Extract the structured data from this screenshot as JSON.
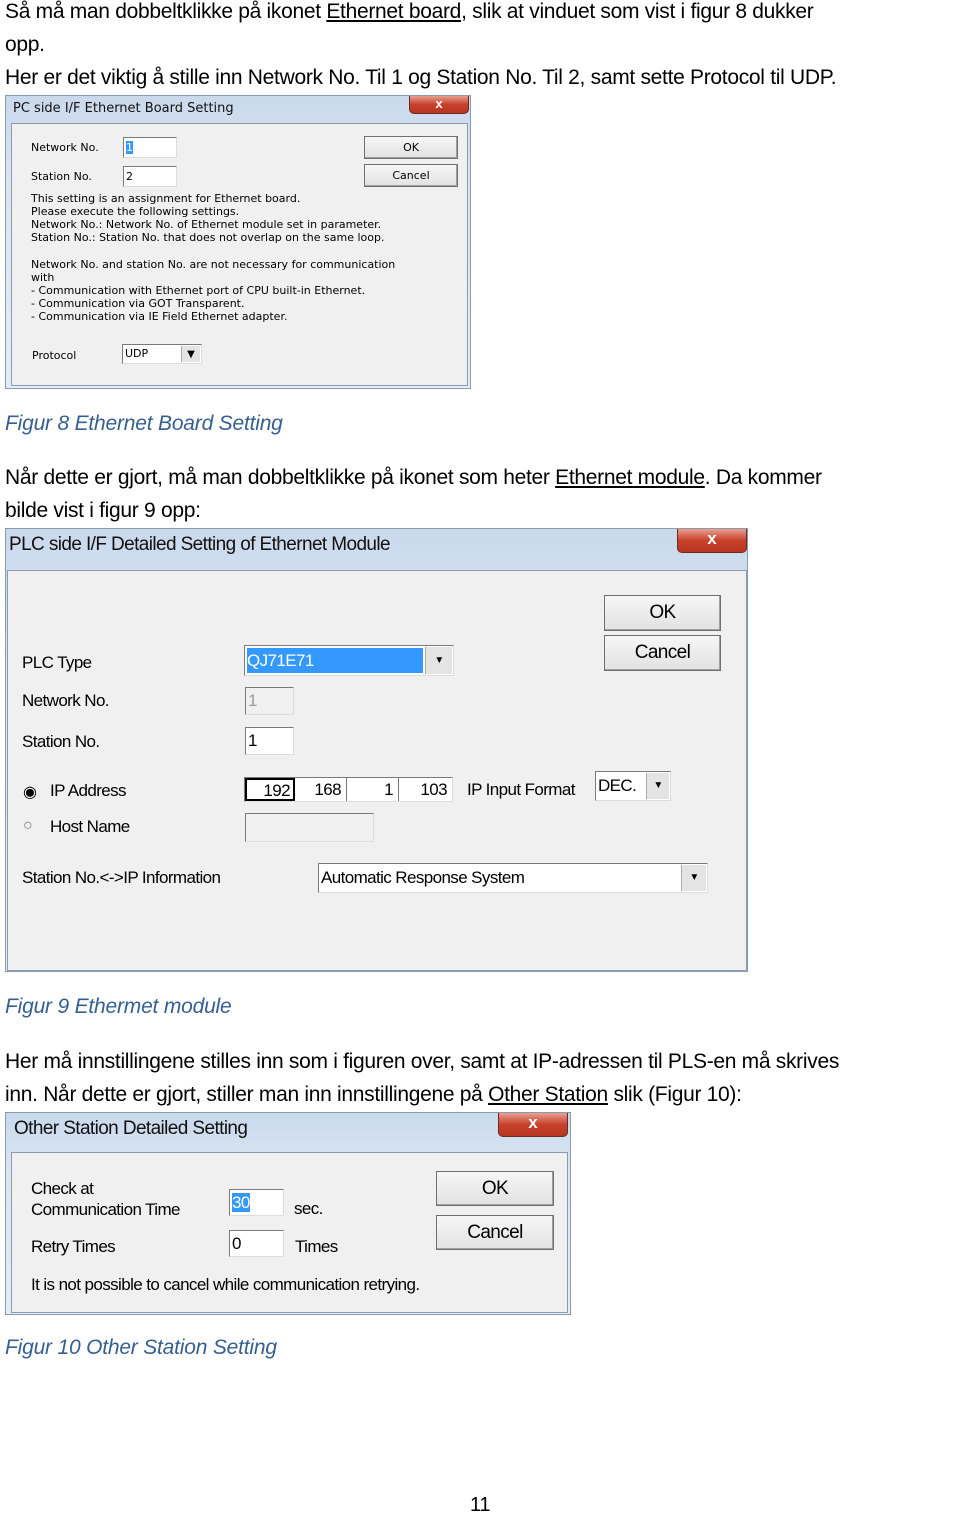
{
  "doc": {
    "p1_a": "Så må man dobbeltklikke på ikonet ",
    "p1_link": "Ethernet board",
    "p1_b": ", slik at vinduet som vist i figur 8 dukker",
    "p1_c": "opp.",
    "p2": "Her er det viktig å stille inn Network No. Til 1 og Station No. Til 2, samt sette Protocol til UDP.",
    "cap8": "Figur 8 Ethernet Board Setting",
    "p3_a": "Når dette er gjort, må man dobbeltklikke på ikonet som heter ",
    "p3_link": "Ethernet module",
    "p3_b": ". Da kommer",
    "p3_c": "bilde vist i figur 9 opp:",
    "cap9": "Figur 9 Ethermet module",
    "p4_a": "Her må innstillingene stilles inn som i figuren over, samt at IP-adressen til PLS-en må skrives",
    "p4_b": "inn. Når dette er gjort, stiller man inn innstillingene på ",
    "p4_link": "Other Station",
    "p4_c": " slik (Figur 10):",
    "cap10": "Figur 10 Other Station Setting",
    "page_number": "11"
  },
  "fig8": {
    "title": "PC side I/F Ethernet Board Setting",
    "close": "x",
    "network_label": "Network No.",
    "network_value": "1",
    "station_label": "Station No.",
    "station_value": "2",
    "ok": "OK",
    "cancel": "Cancel",
    "info": [
      "This setting is an assignment for Ethernet board.",
      "Please execute the following settings.",
      "Network No.: Network No. of Ethernet module set in parameter.",
      "Station No.: Station No. that does not overlap on the same loop."
    ],
    "info2": [
      "Network No. and station No. are not necessary for communication",
      "with",
      "- Communication with Ethernet port of CPU built-in Ethernet.",
      "- Communication via GOT Transparent.",
      "- Communication via IE Field Ethernet adapter."
    ],
    "protocol_label": "Protocol",
    "protocol_value": "UDP"
  },
  "fig9": {
    "title": "PLC side I/F Detailed Setting of Ethernet Module",
    "close": "x",
    "ok": "OK",
    "cancel": "Cancel",
    "plc_type_label": "PLC Type",
    "plc_type_value": "QJ71E71",
    "network_label": "Network No.",
    "network_value": "1",
    "station_label": "Station No.",
    "station_value": "1",
    "ip_label": "IP Address",
    "ip": [
      "192",
      "168",
      "1",
      "103"
    ],
    "ip_format_label": "IP Input Format",
    "ip_format_value": "DEC.",
    "host_label": "Host Name",
    "host_value": "",
    "info_label": "Station No.<->IP Information",
    "info_value": "Automatic Response System",
    "selected_radio": "IP Address"
  },
  "fig10": {
    "title": "Other Station Detailed Setting",
    "close": "x",
    "check_label_1": "Check at",
    "check_label_2": "Communication Time",
    "check_value": "30",
    "check_unit": "sec.",
    "retry_label": "Retry Times",
    "retry_value": "0",
    "retry_unit": "Times",
    "ok": "OK",
    "cancel": "Cancel",
    "note": "It is not possible to cancel while communication retrying."
  }
}
